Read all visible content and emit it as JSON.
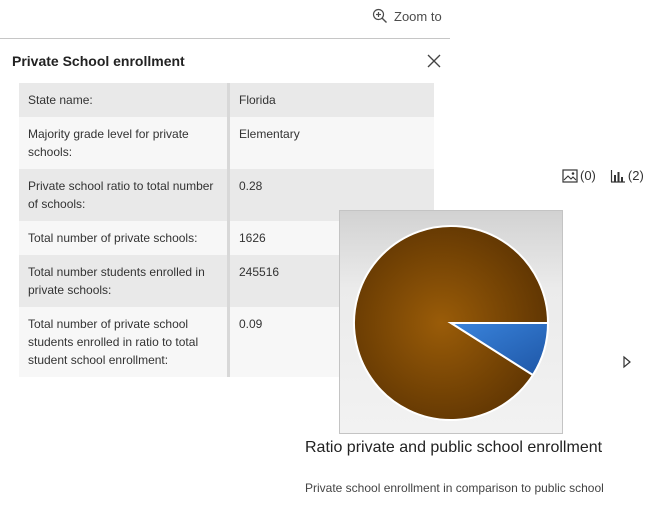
{
  "toolbar": {
    "zoom_label": "Zoom to",
    "zoom_icon": "zoom-in-icon"
  },
  "popup": {
    "title": "Private School enrollment",
    "close_icon": "close-icon",
    "fields": [
      {
        "key": "State name:",
        "value": "Florida"
      },
      {
        "key": "Majority grade level for private schools:",
        "value": "Elementary"
      },
      {
        "key": "Private school ratio to total number of schools:",
        "value": "0.28"
      },
      {
        "key": "Total number of private schools:",
        "value": "1626"
      },
      {
        "key": "Total number students enrolled in private schools:",
        "value": "245516"
      },
      {
        "key": "Total number of private school students enrolled in ratio to total student school enrollment:",
        "value": "0.09"
      }
    ]
  },
  "media": {
    "image_count": "(0)",
    "chart_count": "(2)",
    "title": "Ratio private and public school enrollment",
    "caption": "Private school enrollment in comparison to public school",
    "next_icon": "play-arrow-icon"
  },
  "colors": {
    "slice_public": "#7a4605",
    "slice_private": "#2f70c4",
    "accent": "#323232"
  },
  "chart_data": {
    "type": "pie",
    "categories": [
      "",
      ""
    ],
    "values": [
      0.91,
      0.09
    ],
    "colors": [
      "#7a4605",
      "#2f70c4"
    ],
    "title": "",
    "legend": "none"
  }
}
